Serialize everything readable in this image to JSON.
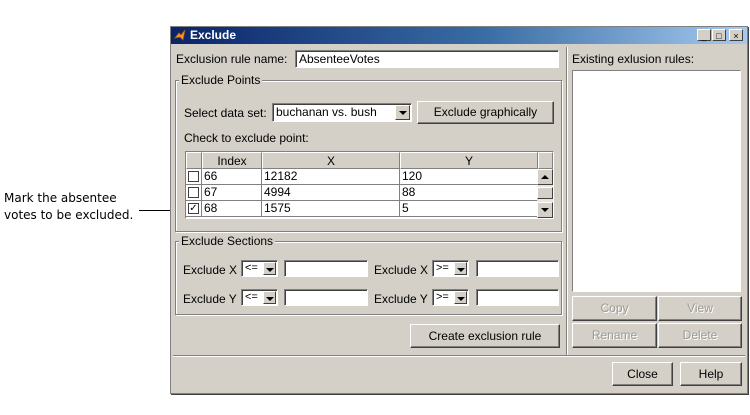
{
  "callout": {
    "line1": "Mark the absentee",
    "line2": "votes to be excluded."
  },
  "window": {
    "title": "Exclude",
    "min": "_",
    "max": "□",
    "close": "×"
  },
  "rule_name": {
    "label": "Exclusion rule name:",
    "value": "AbsenteeVotes"
  },
  "points_group": {
    "title": "Exclude Points",
    "dataset_label": "Select data set:",
    "dataset_value": "buchanan vs. bush",
    "exclude_graphically": "Exclude graphically",
    "check_label": "Check to exclude point:",
    "columns": [
      "Index",
      "X",
      "Y"
    ],
    "rows": [
      {
        "checked": false,
        "index": "66",
        "x": "12182",
        "y": "120"
      },
      {
        "checked": false,
        "index": "67",
        "x": "4994",
        "y": "88"
      },
      {
        "checked": true,
        "index": "68",
        "x": "1575",
        "y": "5"
      }
    ]
  },
  "sections_group": {
    "title": "Exclude Sections",
    "x_label": "Exclude X",
    "y_label": "Exclude Y",
    "lte": "<=",
    "gte": ">="
  },
  "create_button": "Create exclusion rule",
  "existing_label": "Existing exlusion rules:",
  "side_buttons": {
    "copy": "Copy",
    "view": "View",
    "rename": "Rename",
    "delete": "Delete"
  },
  "footer": {
    "close": "Close",
    "help": "Help"
  },
  "colors": {
    "face": "#d4d0c8",
    "title_start": "#0a246a",
    "title_end": "#a6caf0"
  }
}
